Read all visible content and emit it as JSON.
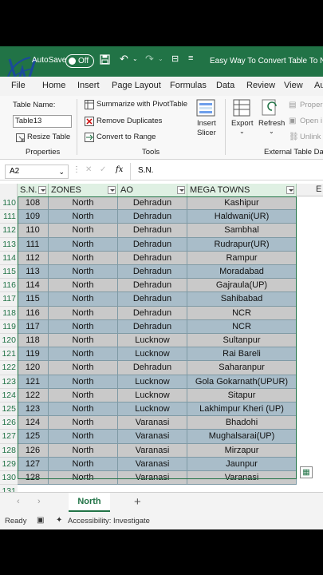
{
  "titlebar": {
    "autosave_label": "AutoSave",
    "toggle_state": "Off",
    "document_title": "Easy Way To Convert Table To Norm",
    "accent_color": "#217346"
  },
  "tabs": [
    "File",
    "Home",
    "Insert",
    "Page Layout",
    "Formulas",
    "Data",
    "Review",
    "View",
    "Au"
  ],
  "ribbon": {
    "properties": {
      "table_name_label": "Table Name:",
      "table_name_value": "Table13",
      "resize_table": "Resize Table",
      "group_label": "Properties"
    },
    "tools": {
      "summarize": "Summarize with PivotTable",
      "remove_duplicates": "Remove Duplicates",
      "convert": "Convert to Range",
      "insert_slicer_1": "Insert",
      "insert_slicer_2": "Slicer",
      "group_label": "Tools"
    },
    "external": {
      "export": "Export",
      "refresh": "Refresh",
      "properties": "Proper",
      "open_in": "Open i",
      "unlink": "Unlink",
      "group_label": "External Table Data"
    }
  },
  "formula_bar": {
    "name_box": "A2",
    "formula": "S.N."
  },
  "grid": {
    "column_letter_e": "E",
    "headers": [
      "S.N.",
      "ZONES",
      "AO",
      "MEGA TOWNS"
    ],
    "rows": [
      {
        "row": "110",
        "sn": "108",
        "zone": "North",
        "ao": "Dehradun",
        "town": "Kashipur"
      },
      {
        "row": "111",
        "sn": "109",
        "zone": "North",
        "ao": "Dehradun",
        "town": "Haldwani(UR)"
      },
      {
        "row": "112",
        "sn": "110",
        "zone": "North",
        "ao": "Dehradun",
        "town": "Sambhal"
      },
      {
        "row": "113",
        "sn": "111",
        "zone": "North",
        "ao": "Dehradun",
        "town": "Rudrapur(UR)"
      },
      {
        "row": "114",
        "sn": "112",
        "zone": "North",
        "ao": "Dehradun",
        "town": "Rampur"
      },
      {
        "row": "115",
        "sn": "113",
        "zone": "North",
        "ao": "Dehradun",
        "town": "Moradabad"
      },
      {
        "row": "116",
        "sn": "114",
        "zone": "North",
        "ao": "Dehradun",
        "town": "Gajraula(UP)"
      },
      {
        "row": "117",
        "sn": "115",
        "zone": "North",
        "ao": "Dehradun",
        "town": "Sahibabad"
      },
      {
        "row": "118",
        "sn": "116",
        "zone": "North",
        "ao": "Dehradun",
        "town": "NCR"
      },
      {
        "row": "119",
        "sn": "117",
        "zone": "North",
        "ao": "Dehradun",
        "town": "NCR"
      },
      {
        "row": "120",
        "sn": "118",
        "zone": "North",
        "ao": "Lucknow",
        "town": "Sultanpur"
      },
      {
        "row": "121",
        "sn": "119",
        "zone": "North",
        "ao": "Lucknow",
        "town": "Rai Bareli"
      },
      {
        "row": "122",
        "sn": "120",
        "zone": "North",
        "ao": "Dehradun",
        "town": "Saharanpur"
      },
      {
        "row": "123",
        "sn": "121",
        "zone": "North",
        "ao": "Lucknow",
        "town": "Gola Gokarnath(UPUR)"
      },
      {
        "row": "124",
        "sn": "122",
        "zone": "North",
        "ao": "Lucknow",
        "town": "Sitapur"
      },
      {
        "row": "125",
        "sn": "123",
        "zone": "North",
        "ao": "Lucknow",
        "town": "Lakhimpur Kheri (UP)"
      },
      {
        "row": "126",
        "sn": "124",
        "zone": "North",
        "ao": "Varanasi",
        "town": "Bhadohi"
      },
      {
        "row": "127",
        "sn": "125",
        "zone": "North",
        "ao": "Varanasi",
        "town": "Mughalsarai(UP)"
      },
      {
        "row": "128",
        "sn": "126",
        "zone": "North",
        "ao": "Varanasi",
        "town": "Mirzapur"
      },
      {
        "row": "129",
        "sn": "127",
        "zone": "North",
        "ao": "Varanasi",
        "town": "Jaunpur"
      },
      {
        "row": "130",
        "sn": "128",
        "zone": "North",
        "ao": "Varanasi",
        "town": "Varanasi"
      }
    ],
    "next_row_number": "131"
  },
  "sheet_tabs": {
    "active": "North",
    "add_label": "+"
  },
  "statusbar": {
    "ready": "Ready",
    "accessibility": "Accessibility: Investigate"
  }
}
